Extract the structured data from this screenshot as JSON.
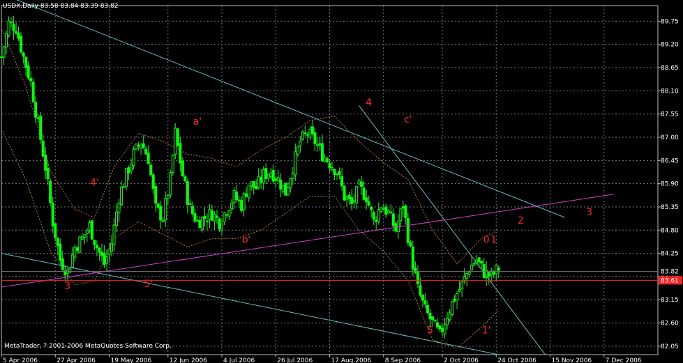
{
  "window": {
    "symbol_label": "USDX,Daily",
    "ohlc_text": "83.58 83.84 83.39 83.82",
    "copyright": "MetaTrader, ? 2001-2006 MetaQuotes Software Corp."
  },
  "colors": {
    "background": "#000000",
    "grid": "#7a7a7a",
    "candle_up": "#00ff00",
    "candle_down": "#00cc00",
    "trendline_cyan": "#5fc0c0",
    "trendline_magenta": "#d040d0",
    "band_orange": "#c07818",
    "current_price_line": "#ff2020",
    "wave_label": "#ff2020",
    "axis_label": "#ffffff",
    "arrow_red": "#ff2020",
    "arrow_blue": "#3030ff"
  },
  "chart_data": {
    "type": "candlestick",
    "title": "USDX,Daily",
    "ylim": [
      81.85,
      90.12
    ],
    "x_range_days": [
      0,
      268
    ],
    "y_ticks": [
      "89.75",
      "89.20",
      "88.65",
      "88.10",
      "87.55",
      "87.00",
      "86.45",
      "85.90",
      "85.35",
      "84.80",
      "84.25",
      "83.70",
      "83.15",
      "82.60",
      "82.05"
    ],
    "y_tick_values": [
      89.75,
      89.2,
      88.65,
      88.1,
      87.55,
      87.0,
      86.45,
      85.9,
      85.35,
      84.8,
      84.25,
      83.7,
      83.15,
      82.6,
      82.05
    ],
    "x_ticks": [
      {
        "label": "5 Apr 2006",
        "day": 0
      },
      {
        "label": "27 Apr 2006",
        "day": 22
      },
      {
        "label": "19 May 2006",
        "day": 44
      },
      {
        "label": "12 Jun 2006",
        "day": 68
      },
      {
        "label": "4 Jul 2006",
        "day": 90
      },
      {
        "label": "26 Jul 2006",
        "day": 112
      },
      {
        "label": "17 Aug 2006",
        "day": 134
      },
      {
        "label": "8 Sep 2006",
        "day": 156
      },
      {
        "label": "2 Oct 2006",
        "day": 180
      },
      {
        "label": "24 Oct 2006",
        "day": 202
      },
      {
        "label": "15 Nov 2006",
        "day": 224
      },
      {
        "label": "7 Dec 2006",
        "day": 246
      }
    ],
    "current_price": {
      "value": 83.82,
      "label": "83.82"
    },
    "horizontal_line": {
      "value": 83.61,
      "label": "83.61"
    },
    "close_path": [
      [
        0,
        88.9
      ],
      [
        3,
        89.7
      ],
      [
        6,
        89.6
      ],
      [
        9,
        88.9
      ],
      [
        12,
        88.3
      ],
      [
        15,
        87.3
      ],
      [
        18,
        86.3
      ],
      [
        21,
        85.0
      ],
      [
        24,
        84.1
      ],
      [
        27,
        83.8
      ],
      [
        30,
        84.4
      ],
      [
        33,
        84.6
      ],
      [
        36,
        84.9
      ],
      [
        39,
        84.4
      ],
      [
        42,
        84.0
      ],
      [
        45,
        84.5
      ],
      [
        48,
        85.6
      ],
      [
        51,
        86.1
      ],
      [
        54,
        86.6
      ],
      [
        57,
        86.9
      ],
      [
        60,
        86.5
      ],
      [
        63,
        85.3
      ],
      [
        66,
        85.1
      ],
      [
        69,
        86.0
      ],
      [
        71,
        87.1
      ],
      [
        74,
        86.1
      ],
      [
        77,
        85.3
      ],
      [
        80,
        85.0
      ],
      [
        83,
        85.1
      ],
      [
        86,
        85.2
      ],
      [
        89,
        85.0
      ],
      [
        92,
        85.3
      ],
      [
        95,
        85.6
      ],
      [
        98,
        85.4
      ],
      [
        101,
        85.9
      ],
      [
        104,
        85.8
      ],
      [
        107,
        86.1
      ],
      [
        110,
        86.2
      ],
      [
        113,
        86.0
      ],
      [
        116,
        85.7
      ],
      [
        119,
        86.3
      ],
      [
        122,
        86.9
      ],
      [
        125,
        87.1
      ],
      [
        128,
        86.9
      ],
      [
        131,
        86.6
      ],
      [
        134,
        86.4
      ],
      [
        137,
        86.2
      ],
      [
        140,
        85.6
      ],
      [
        143,
        85.4
      ],
      [
        146,
        85.8
      ],
      [
        149,
        85.6
      ],
      [
        152,
        85.0
      ],
      [
        155,
        85.4
      ],
      [
        158,
        85.2
      ],
      [
        161,
        84.8
      ],
      [
        164,
        85.4
      ],
      [
        167,
        84.3
      ],
      [
        170,
        83.4
      ],
      [
        173,
        82.9
      ],
      [
        176,
        82.6
      ],
      [
        179,
        82.3
      ],
      [
        182,
        82.8
      ],
      [
        185,
        83.2
      ],
      [
        188,
        83.5
      ],
      [
        191,
        83.9
      ],
      [
        194,
        84.1
      ],
      [
        197,
        83.8
      ],
      [
        200,
        83.7
      ],
      [
        203,
        83.9
      ]
    ],
    "bands": [
      {
        "name": "upper",
        "points": [
          [
            0,
            89.6
          ],
          [
            10,
            88.2
          ],
          [
            20,
            86.2
          ],
          [
            30,
            85.3
          ],
          [
            38,
            85.1
          ],
          [
            46,
            86.3
          ],
          [
            56,
            87.1
          ],
          [
            66,
            86.9
          ],
          [
            76,
            86.6
          ],
          [
            86,
            86.5
          ],
          [
            96,
            86.3
          ],
          [
            106,
            86.7
          ],
          [
            116,
            87.0
          ],
          [
            126,
            87.4
          ],
          [
            136,
            87.5
          ],
          [
            146,
            86.9
          ],
          [
            156,
            86.4
          ],
          [
            166,
            86.0
          ],
          [
            176,
            84.8
          ],
          [
            186,
            84.0
          ],
          [
            196,
            84.6
          ],
          [
            203,
            84.8
          ]
        ]
      },
      {
        "name": "lower",
        "points": [
          [
            0,
            87.2
          ],
          [
            10,
            86.0
          ],
          [
            20,
            84.3
          ],
          [
            30,
            83.5
          ],
          [
            38,
            83.6
          ],
          [
            46,
            84.6
          ],
          [
            56,
            85.0
          ],
          [
            66,
            84.7
          ],
          [
            76,
            84.4
          ],
          [
            86,
            84.6
          ],
          [
            96,
            84.6
          ],
          [
            106,
            84.8
          ],
          [
            116,
            85.2
          ],
          [
            126,
            85.6
          ],
          [
            136,
            85.6
          ],
          [
            146,
            84.8
          ],
          [
            156,
            84.3
          ],
          [
            166,
            83.6
          ],
          [
            176,
            82.2
          ],
          [
            186,
            82.0
          ],
          [
            196,
            82.5
          ],
          [
            203,
            82.9
          ]
        ]
      }
    ],
    "trendlines": [
      {
        "name": "upper-channel",
        "color": "cyan",
        "from": [
          0,
          90.4
        ],
        "to": [
          230,
          85.1
        ]
      },
      {
        "name": "lower-channel",
        "color": "cyan",
        "from": [
          0,
          84.25
        ],
        "to": [
          203,
          81.85
        ]
      },
      {
        "name": "steep-line",
        "color": "cyan",
        "from": [
          146,
          87.75
        ],
        "to": [
          222,
          81.85
        ]
      },
      {
        "name": "support-line",
        "color": "magenta",
        "from": [
          0,
          83.45
        ],
        "to": [
          250,
          85.65
        ]
      }
    ],
    "wave_labels": [
      {
        "text": "3",
        "day": 27,
        "value": 83.4
      },
      {
        "text": "4'",
        "day": 38,
        "value": 85.85
      },
      {
        "text": "5'",
        "day": 60,
        "value": 83.45
      },
      {
        "text": "a'",
        "day": 80,
        "value": 87.3
      },
      {
        "text": "b'",
        "day": 100,
        "value": 84.5
      },
      {
        "text": "4",
        "day": 150,
        "value": 87.75
      },
      {
        "text": "c'",
        "day": 166,
        "value": 87.35
      },
      {
        "text": "5",
        "day": 175,
        "value": 82.35
      },
      {
        "text": "1'",
        "day": 198,
        "value": 82.35
      },
      {
        "text": "0",
        "day": 198,
        "value": 84.5
      },
      {
        "text": "1",
        "day": 201,
        "value": 84.5
      },
      {
        "text": "2",
        "day": 212,
        "value": 84.95
      },
      {
        "text": "3",
        "day": 240,
        "value": 85.15
      }
    ]
  }
}
